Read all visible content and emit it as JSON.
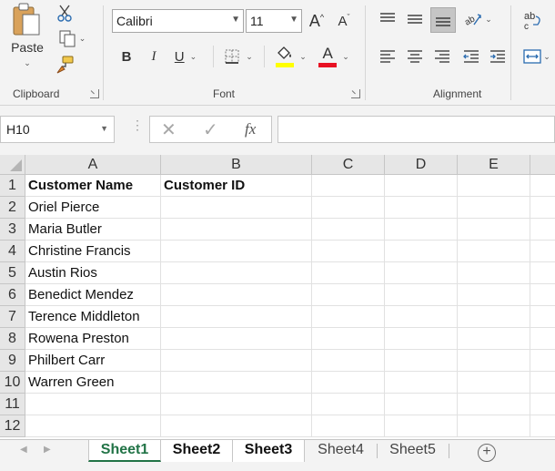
{
  "ribbon": {
    "clipboard": {
      "label": "Clipboard",
      "paste_label": "Paste"
    },
    "font": {
      "label": "Font",
      "font_name": "Calibri",
      "font_size": "11",
      "bold": "B",
      "italic": "I",
      "underline": "U",
      "highlight_color": "#ffff00",
      "font_color": "#e81123"
    },
    "alignment": {
      "label": "Alignment"
    }
  },
  "formula_bar": {
    "name_box": "H10",
    "fx": "fx",
    "value": ""
  },
  "columns": [
    "A",
    "B",
    "C",
    "D",
    "E"
  ],
  "rows": [
    {
      "num": "1",
      "a": "Customer Name",
      "b": "Customer ID"
    },
    {
      "num": "2",
      "a": "Oriel Pierce",
      "b": ""
    },
    {
      "num": "3",
      "a": "Maria Butler",
      "b": ""
    },
    {
      "num": "4",
      "a": "Christine Francis",
      "b": ""
    },
    {
      "num": "5",
      "a": "Austin Rios",
      "b": ""
    },
    {
      "num": "6",
      "a": "Benedict Mendez",
      "b": ""
    },
    {
      "num": "7",
      "a": "Terence Middleton",
      "b": ""
    },
    {
      "num": "8",
      "a": "Rowena Preston",
      "b": ""
    },
    {
      "num": "9",
      "a": "Philbert Carr",
      "b": ""
    },
    {
      "num": "10",
      "a": "Warren Green",
      "b": ""
    },
    {
      "num": "11",
      "a": "",
      "b": ""
    },
    {
      "num": "12",
      "a": "",
      "b": ""
    }
  ],
  "sheets": [
    {
      "name": "Sheet1",
      "state": "active"
    },
    {
      "name": "Sheet2",
      "state": "grouped"
    },
    {
      "name": "Sheet3",
      "state": "grouped"
    },
    {
      "name": "Sheet4",
      "state": "normal"
    },
    {
      "name": "Sheet5",
      "state": "normal"
    }
  ],
  "accent_color": "#217346"
}
